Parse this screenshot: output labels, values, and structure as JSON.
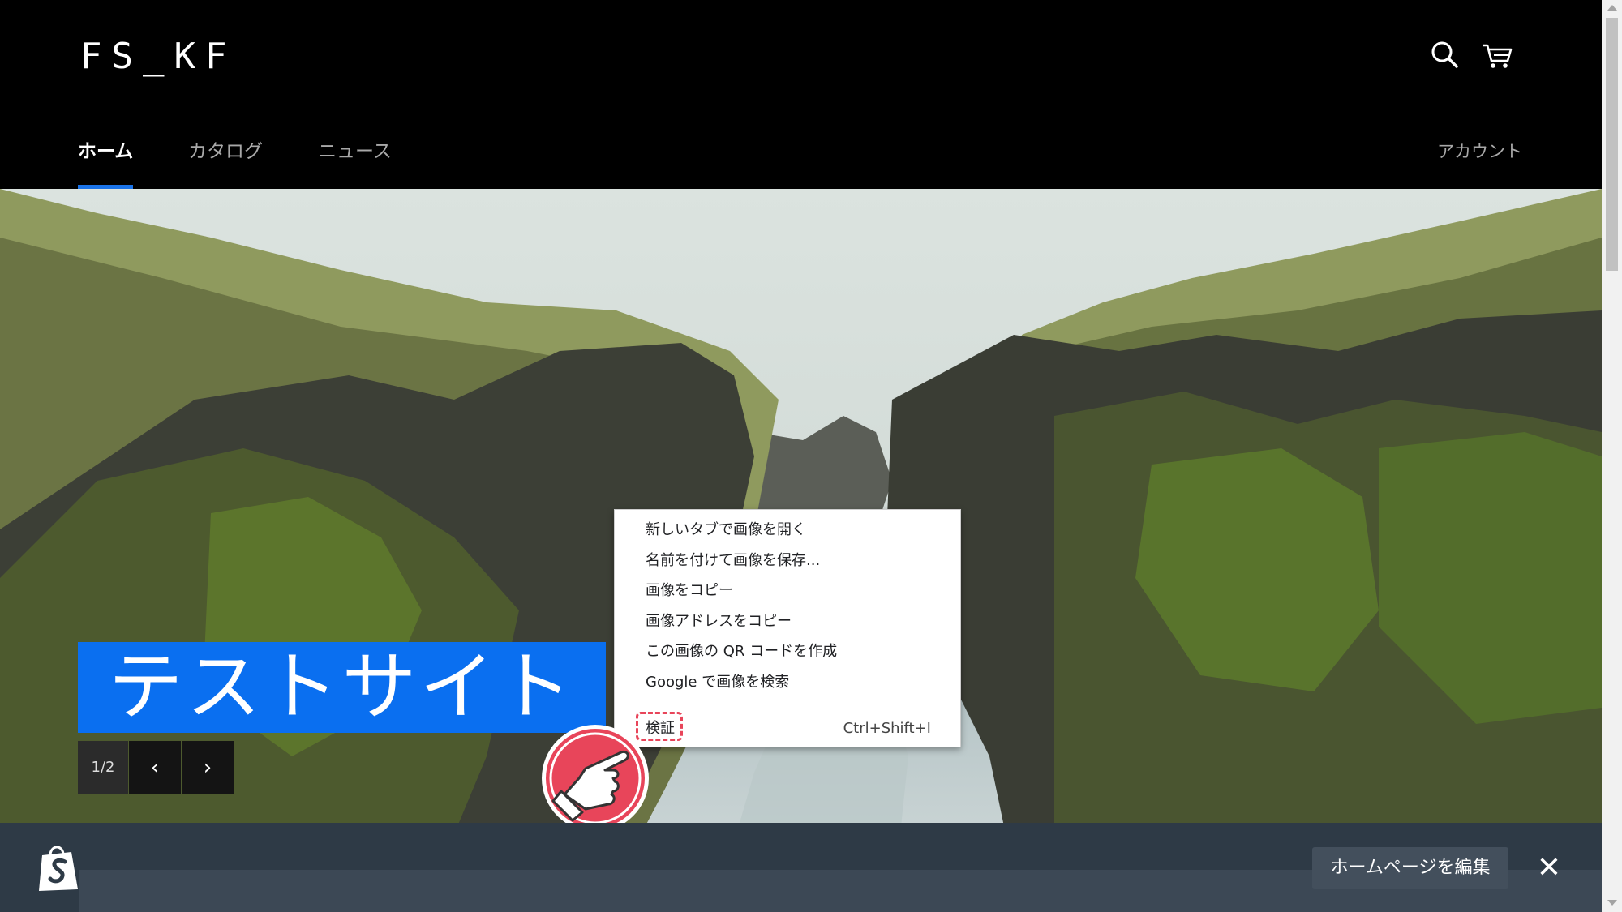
{
  "header": {
    "logo": "FS_KF",
    "icons": {
      "search": "search-icon",
      "cart": "cart-icon"
    }
  },
  "nav": {
    "items": [
      {
        "label": "ホーム",
        "active": true
      },
      {
        "label": "カタログ",
        "active": false
      },
      {
        "label": "ニュース",
        "active": false
      }
    ],
    "account": "アカウント",
    "accent_color": "#1a73e8"
  },
  "hero": {
    "title": "テストサイト",
    "title_bg_color": "#0a6ff0",
    "slide_counter": "1/2",
    "prev_icon": "chevron-left-icon",
    "next_icon": "chevron-right-icon"
  },
  "context_menu": {
    "items": [
      "新しいタブで画像を開く",
      "名前を付けて画像を保存...",
      "画像をコピー",
      "画像アドレスをコピー",
      "この画像の QR コードを作成",
      "Google で画像を検索"
    ],
    "inspect": {
      "label": "検証",
      "shortcut": "Ctrl+Shift+I"
    },
    "highlight_color": "#e8455a"
  },
  "pointer": {
    "icon": "pointing-hand-icon",
    "color": "#e8455a"
  },
  "admin_bar": {
    "logo_icon": "shopify-bag-icon",
    "edit_label": "ホームページを編集",
    "close_label": "✕"
  }
}
